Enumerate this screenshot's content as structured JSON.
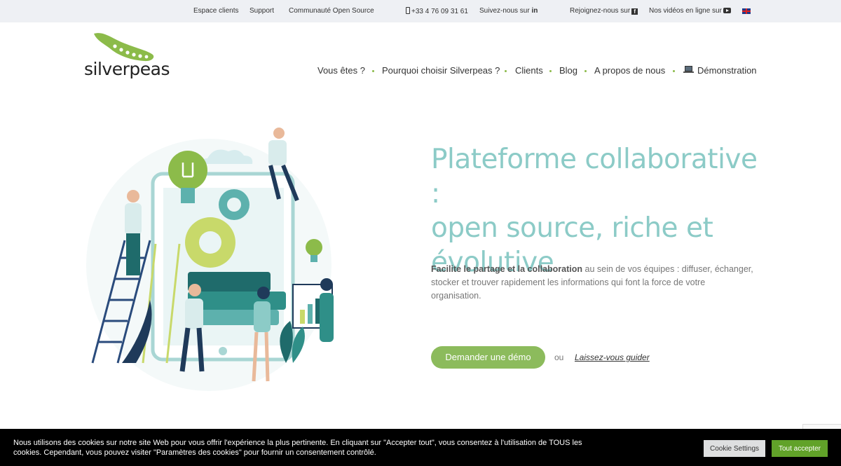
{
  "topbar": {
    "espace_clients": "Espace clients",
    "support": "Support",
    "communaute": "Communauté Open Source",
    "phone": "+33 4 76 09 31 61",
    "suivez": "Suivez-nous sur",
    "linkedin": "in",
    "rejoignez": "Rejoignez-nous sur",
    "facebook": "f",
    "videos": "Nos vidéos en ligne sur",
    "language_flag": "uk-flag-icon"
  },
  "brand": {
    "name": "silverpeas",
    "color": "#8cbb4a"
  },
  "nav": {
    "items": [
      "Vous êtes ?",
      "Pourquoi choisir Silverpeas ?",
      "Clients",
      "Blog",
      "A propos de nous",
      "Démonstration"
    ]
  },
  "hero": {
    "title_line1": "Plateforme collaborative :",
    "title_line2": "open source, riche et",
    "title_line3": "évolutive",
    "desc_highlight": "Facilite le partage et la collaboration",
    "desc_rest": " au sein de vos équipes : diffuser, échanger, stocker et trouver rapidement les informations qui font la force de votre organisation.",
    "cta_label": "Demander une démo",
    "or_label": "ou",
    "guide_label": "Laissez-vous guider",
    "title_color": "#8ccbc7",
    "cta_color": "#8cbb5c"
  },
  "cookie": {
    "text": "Nous utilisons des cookies sur notre site Web pour vous offrir l'expérience la plus pertinente. En cliquant sur \"Accepter tout\", vous consentez à l'utilisation de TOUS les cookies. Cependant, vous pouvez visiter \"Paramètres des cookies\" pour fournir un consentement contrôlé.",
    "settings_label": "Cookie Settings",
    "accept_label": "Tout accepter",
    "accept_color": "#61a229"
  }
}
